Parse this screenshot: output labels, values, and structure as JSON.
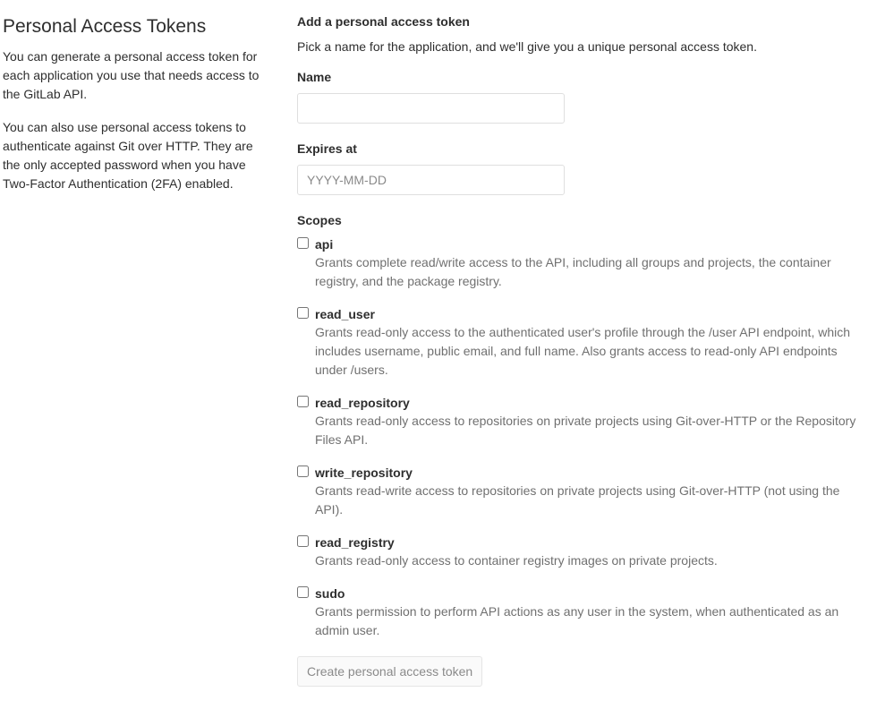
{
  "left": {
    "title": "Personal Access Tokens",
    "paragraph1": "You can generate a personal access token for each application you use that needs access to the GitLab API.",
    "paragraph2": "You can also use personal access tokens to authenticate against Git over HTTP. They are the only accepted password when you have Two-Factor Authentication (2FA) enabled."
  },
  "form": {
    "heading": "Add a personal access token",
    "description": "Pick a name for the application, and we'll give you a unique personal access token.",
    "name_label": "Name",
    "name_value": "",
    "expires_label": "Expires at",
    "expires_placeholder": "YYYY-MM-DD",
    "scopes_label": "Scopes",
    "scopes": [
      {
        "name": "api",
        "checked": false,
        "description": "Grants complete read/write access to the API, including all groups and projects, the container registry, and the package registry."
      },
      {
        "name": "read_user",
        "checked": false,
        "description": "Grants read-only access to the authenticated user's profile through the /user API endpoint, which includes username, public email, and full name. Also grants access to read-only API endpoints under /users."
      },
      {
        "name": "read_repository",
        "checked": false,
        "description": "Grants read-only access to repositories on private projects using Git-over-HTTP or the Repository Files API."
      },
      {
        "name": "write_repository",
        "checked": false,
        "description": "Grants read-write access to repositories on private projects using Git-over-HTTP (not using the API)."
      },
      {
        "name": "read_registry",
        "checked": false,
        "description": "Grants read-only access to container registry images on private projects."
      },
      {
        "name": "sudo",
        "checked": false,
        "description": "Grants permission to perform API actions as any user in the system, when authenticated as an admin user."
      }
    ],
    "submit_label": "Create personal access token"
  }
}
